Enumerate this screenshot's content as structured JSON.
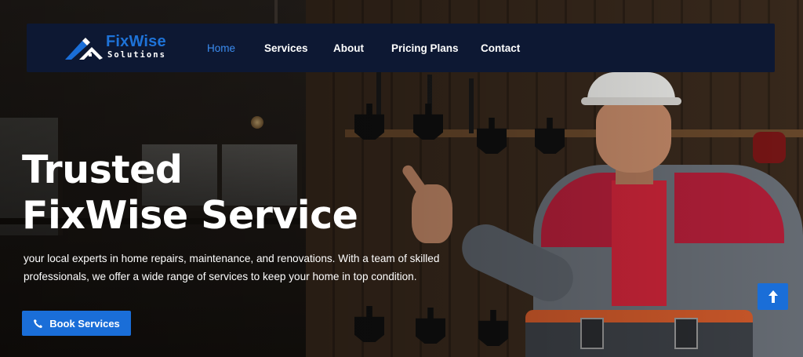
{
  "brand": {
    "name": "FixWise",
    "tagline": "Solutions",
    "accent_color": "#1a6ed8"
  },
  "nav": {
    "items": [
      {
        "label": "Home",
        "active": true
      },
      {
        "label": "Services",
        "active": false
      },
      {
        "label": "About",
        "active": false
      },
      {
        "label": "Pricing Plans",
        "active": false
      },
      {
        "label": "Contact",
        "active": false
      }
    ]
  },
  "hero": {
    "title_line1": "Trusted",
    "title_line2": "FixWise Service",
    "description": "your local experts in home repairs, maintenance, and renovations. With a team of skilled professionals, we offer a wide range of services to keep your home in top condition.",
    "cta_label": "Book Services",
    "cta_icon": "phone-icon"
  },
  "scroll_top": {
    "icon": "arrow-up-icon"
  }
}
